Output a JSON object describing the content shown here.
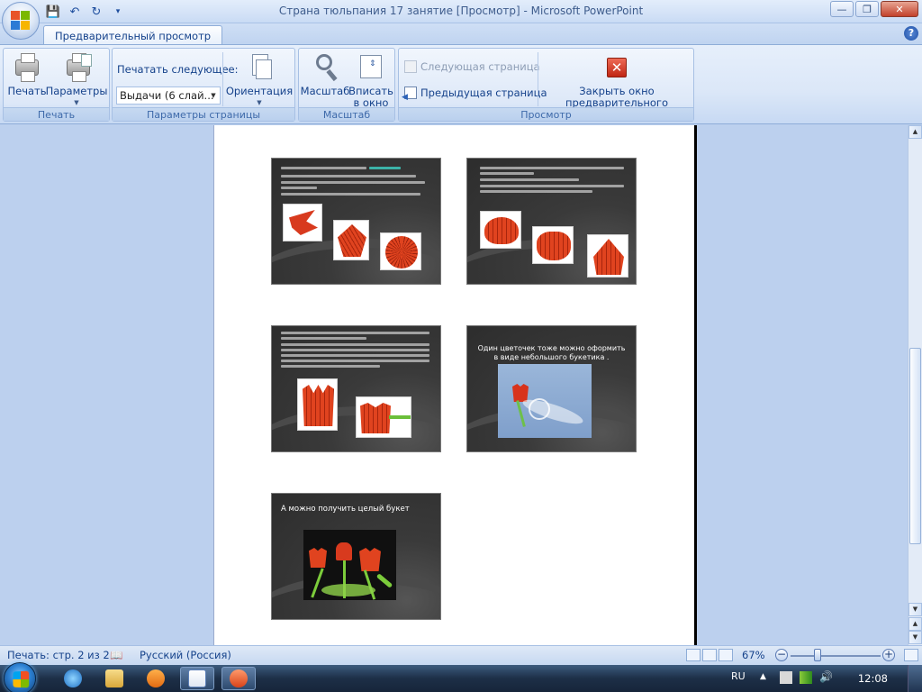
{
  "window": {
    "title": "Страна тюльпания 17 занятие [Просмотр] - Microsoft PowerPoint",
    "minimize": "—",
    "maximize": "❐",
    "close": "✕"
  },
  "quick_access": {
    "save": "💾",
    "undo": "↶",
    "redo": "↻",
    "customize": "▾"
  },
  "tabs": [
    {
      "label": "Предварительный просмотр",
      "active": true
    }
  ],
  "help": "?",
  "ribbon": {
    "groups": [
      {
        "label": "Печать",
        "buttons": [
          "Печать",
          "Параметры"
        ]
      },
      {
        "label": "Параметры страницы",
        "print_what_label": "Печатать следующее:",
        "print_what_value": "Выдачи (6 слай...",
        "orientation": "Ориентация"
      },
      {
        "label": "Масштаб",
        "zoom": "Масштаб",
        "fit_line1": "Вписать",
        "fit_line2": "в окно"
      },
      {
        "label": "Просмотр",
        "next_page": "Следующая страница",
        "prev_page": "Предыдущая страница",
        "close_line1": "Закрыть окно",
        "close_line2": "предварительного просмотра"
      }
    ]
  },
  "slides": [
    {
      "id": 1,
      "kind": "text_with_pics"
    },
    {
      "id": 2,
      "kind": "text_with_pics"
    },
    {
      "id": 3,
      "kind": "text_with_pics"
    },
    {
      "id": 4,
      "kind": "caption",
      "caption_line1": "Один цветочек тоже можно оформить",
      "caption_line2": "в виде небольшого букетика ."
    },
    {
      "id": 5,
      "kind": "caption",
      "caption_line1": "А можно получить целый букет"
    }
  ],
  "statusbar": {
    "page_info": "Печать: стр. 2 из 2",
    "language": "Русский (Россия)",
    "zoom_percent": "67%",
    "zoom_level": 0.34,
    "zoom_out": "−",
    "zoom_in": "+"
  },
  "taskbar": {
    "language": "RU",
    "clock": "12:08"
  },
  "colors": {
    "ribbon_text": "#15428b",
    "slide_bg": "#2d2d2d",
    "accent_red": "#d9401f",
    "highlight_text": "#3fd3c7"
  }
}
